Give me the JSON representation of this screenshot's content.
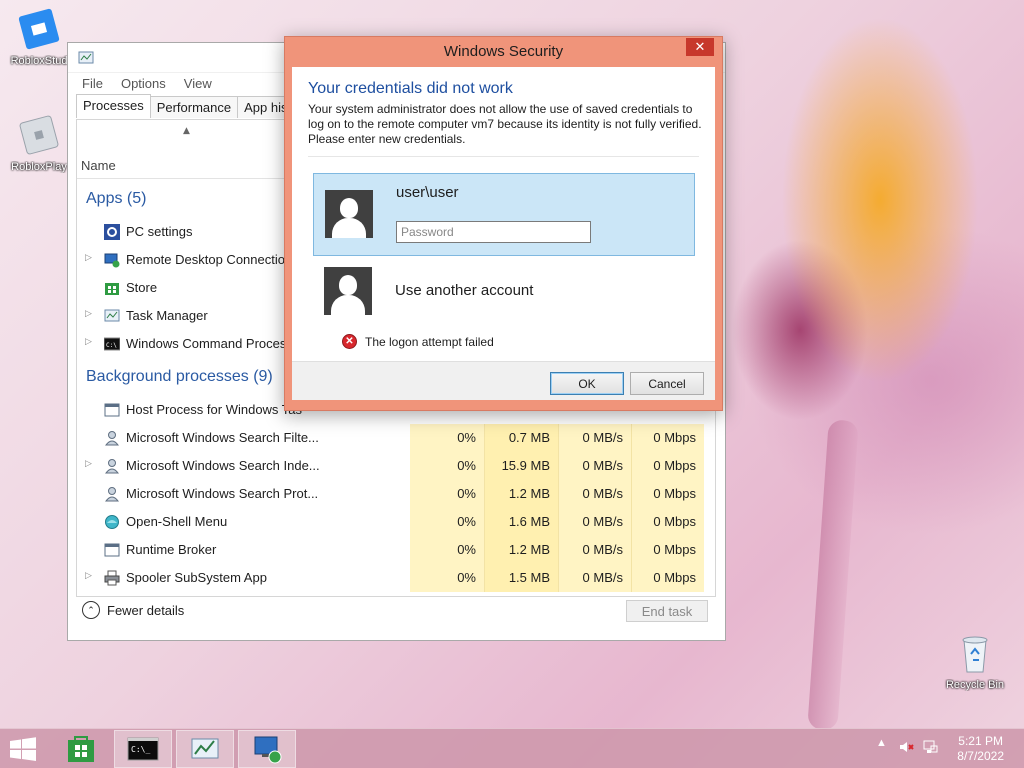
{
  "desktop": {
    "icons": [
      {
        "label": "RobloxStud"
      },
      {
        "label": "RobloxPlay"
      },
      {
        "label": "Recycle Bin"
      }
    ]
  },
  "task_manager": {
    "menu": [
      "File",
      "Options",
      "View"
    ],
    "tabs": [
      "Processes",
      "Performance",
      "App history"
    ],
    "name_column": "Name",
    "apps_header": "Apps (5)",
    "apps": [
      {
        "name": "PC settings",
        "expandable": false
      },
      {
        "name": "Remote Desktop Connection",
        "expandable": true
      },
      {
        "name": "Store",
        "expandable": false
      },
      {
        "name": "Task Manager",
        "expandable": true
      },
      {
        "name": "Windows Command Processo",
        "expandable": true
      }
    ],
    "bg_header": "Background processes (9)",
    "bg_processes": [
      {
        "name": "Host Process for Windows Tas",
        "expandable": false,
        "cpu": "",
        "memory": "",
        "disk": "",
        "network": ""
      },
      {
        "name": "Microsoft Windows Search Filte...",
        "expandable": false,
        "cpu": "0%",
        "memory": "0.7 MB",
        "disk": "0 MB/s",
        "network": "0 Mbps"
      },
      {
        "name": "Microsoft Windows Search Inde...",
        "expandable": true,
        "cpu": "0%",
        "memory": "15.9 MB",
        "disk": "0 MB/s",
        "network": "0 Mbps"
      },
      {
        "name": "Microsoft Windows Search Prot...",
        "expandable": false,
        "cpu": "0%",
        "memory": "1.2 MB",
        "disk": "0 MB/s",
        "network": "0 Mbps"
      },
      {
        "name": "Open-Shell Menu",
        "expandable": false,
        "cpu": "0%",
        "memory": "1.6 MB",
        "disk": "0 MB/s",
        "network": "0 Mbps"
      },
      {
        "name": "Runtime Broker",
        "expandable": false,
        "cpu": "0%",
        "memory": "1.2 MB",
        "disk": "0 MB/s",
        "network": "0 Mbps"
      },
      {
        "name": "Spooler SubSystem App",
        "expandable": true,
        "cpu": "0%",
        "memory": "1.5 MB",
        "disk": "0 MB/s",
        "network": "0 Mbps"
      }
    ],
    "fewer_details": "Fewer details",
    "end_task": "End task"
  },
  "dialog": {
    "title": "Windows Security",
    "close_glyph": "✕",
    "heading": "Your credentials did not work",
    "message": "Your system administrator does not allow the use of saved credentials to log on to the remote computer vm7 because its identity is not fully verified. Please enter new credentials.",
    "account_name": "user\\user",
    "password_placeholder": "Password",
    "password_value": "",
    "other_account": "Use another account",
    "error_text": "The logon attempt failed",
    "ok": "OK",
    "cancel": "Cancel"
  },
  "taskbar": {
    "time": "5:21 PM",
    "date": "8/7/2022"
  }
}
